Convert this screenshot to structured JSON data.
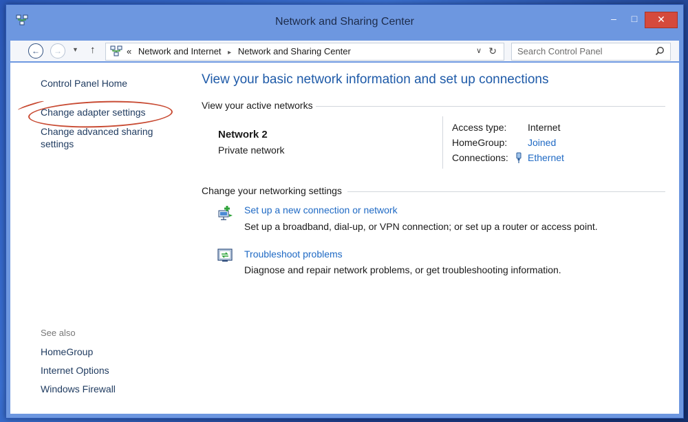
{
  "window": {
    "title": "Network and Sharing Center",
    "minimize_glyph": "–",
    "maximize_glyph": "□",
    "close_glyph": "✕"
  },
  "addressbar": {
    "back_glyph": "←",
    "forward_glyph": "→",
    "recent_glyph": "▼",
    "up_glyph": "↑",
    "overflow_glyph": "«",
    "crumbs": [
      "Network and Internet",
      "Network and Sharing Center"
    ],
    "crumb_separator": "▸",
    "dropdown_glyph": "∨",
    "refresh_glyph": "↻",
    "search_placeholder": "Search Control Panel"
  },
  "left_pane": {
    "home": "Control Panel Home",
    "change_adapter": "Change adapter settings",
    "change_advanced": "Change advanced sharing settings",
    "see_also_label": "See also",
    "see_also": [
      "HomeGroup",
      "Internet Options",
      "Windows Firewall"
    ]
  },
  "main": {
    "title": "View your basic network information and set up connections",
    "active_section": "View your active networks",
    "network": {
      "name": "Network  2",
      "category": "Private network",
      "access_type_label": "Access type:",
      "access_type": "Internet",
      "homegroup_label": "HomeGroup:",
      "homegroup": "Joined",
      "connections_label": "Connections:",
      "connection": "Ethernet"
    },
    "change_section": "Change your networking settings",
    "tasks": [
      {
        "link": "Set up a new connection or network",
        "desc": "Set up a broadband, dial-up, or VPN connection; or set up a router or access point."
      },
      {
        "link": "Troubleshoot problems",
        "desc": "Diagnose and repair network problems, or get troubleshooting information."
      }
    ]
  },
  "colors": {
    "link": "#1e69c4",
    "title_blue": "#1e5aa8",
    "annotation_red": "#c84a32",
    "frame": "#6d97e0",
    "close_button": "#d54a3c"
  },
  "icons": {
    "title": "network-center-icon",
    "crumb": "network-center-icon",
    "search": "search-icon",
    "ethernet": "ethernet-icon",
    "new_connection": "new-connection-icon",
    "troubleshoot": "troubleshoot-icon"
  }
}
